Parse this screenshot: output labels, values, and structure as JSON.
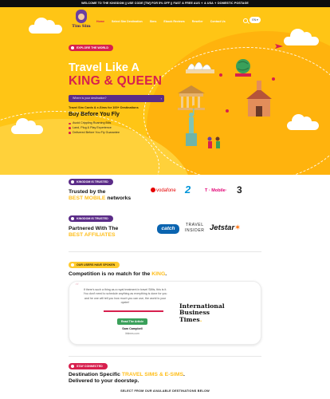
{
  "promo_bar": {
    "text": "WELCOME TO THE KINGDOM || USE CODE [TW] FOR 5% OFF || FAST & FREE AUS ✈ & USA ✈ DOMESTIC POSTAGE"
  },
  "brand": {
    "logo_text": "Tim Sim"
  },
  "nav": {
    "items": [
      {
        "label": "Home",
        "active": true
      },
      {
        "label": "Select Sim Destination",
        "active": false
      },
      {
        "label": "Sims",
        "active": false
      },
      {
        "label": "Ebook Reviews",
        "active": false
      },
      {
        "label": "Reseller",
        "active": false
      },
      {
        "label": "Contact Us",
        "active": false
      }
    ],
    "lang_label": "EN ▾"
  },
  "hero": {
    "badge": "EXPLORE THE WORLD",
    "title_line1": "Travel Like A",
    "title_line2": "KING & QUEEN",
    "search_placeholder": "Where is your destination?",
    "search_arrow": "›",
    "subtitle": "Travel Sim Cards & e-Sims for 100+ Destinations",
    "cta_heading": "Buy Before You Fly",
    "bullets": [
      "Avoid Crippling Roaming Bills",
      "Land, Plug & Play Experience",
      "Delivered Before You Fly Guarantee"
    ]
  },
  "trusted_networks": {
    "badge": "KINGDOM IS TRUSTED",
    "title_line1": "Trusted by the",
    "title_highlight": "BEST MOBILE",
    "title_rest": " networks",
    "logos": [
      "vodafone",
      "2",
      "T · Mobile·",
      "3"
    ]
  },
  "affiliates": {
    "badge": "KINGDOM IS TRUSTED",
    "title_line1": "Partnered With The",
    "title_highlight": "BEST AFFILIATES",
    "logos": {
      "catch": "catch",
      "travel_insider_line1": "TRAVEL",
      "travel_insider_line2": "INSIDER",
      "jetstar": "Jetstar",
      "jetstar_star": "✶"
    }
  },
  "reviews": {
    "badge": "OUR USERS HAVE SPOKEN",
    "title_prefix": "Competition is no match for the ",
    "title_highlight": "KING",
    "title_suffix": ".",
    "quote_mark": "“",
    "quote": "If there's such a thing as a royal treatment in travel SIMs, this is it. You don't need to schedule anything as everything is done for you and he one will tell you how much you can use, the world is your oyster!",
    "button": "Read The Article",
    "reviewer_name": "Sam Campbell",
    "reviewer_org": "ibtimes.com",
    "publisher_line1": "International",
    "publisher_line2": "Business",
    "publisher_line3": "Times",
    "publisher_dot": "."
  },
  "destinations": {
    "badge": "STAY CONNECTED",
    "title_prefix": "Destination Specific ",
    "title_highlight": "TRAVEL SIMS & E-SIMS",
    "title_suffix": ".",
    "title_line2": "Delivered to your doorstep.",
    "caption": "SELECT FROM OUR AVAILABLE DESTINATIONS BELOW"
  },
  "colors": {
    "hero_yellow": "#ffc515",
    "brand_red": "#d7204e",
    "brand_purple": "#5b2c88",
    "highlight_gold": "#ffbe1a"
  }
}
